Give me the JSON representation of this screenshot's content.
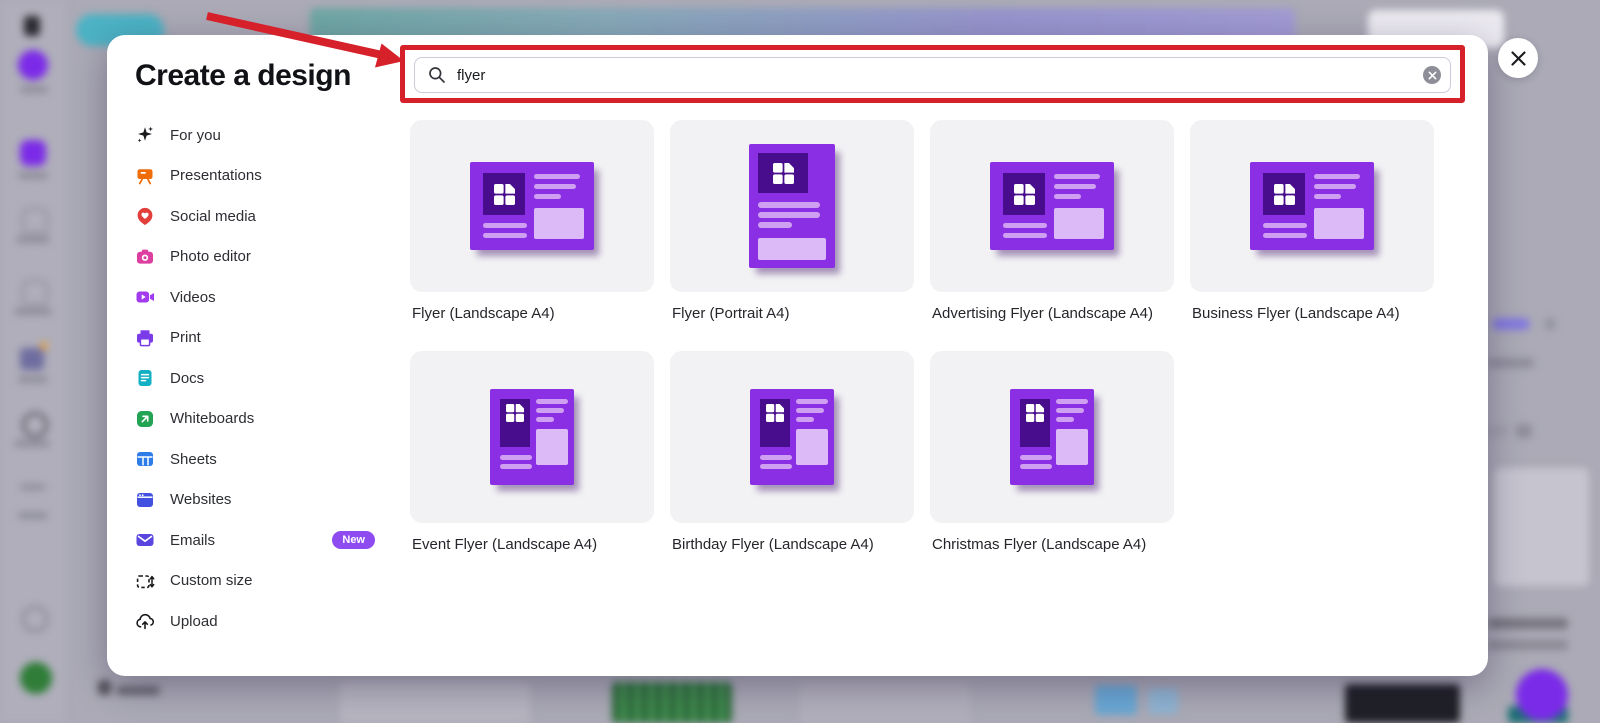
{
  "colors": {
    "annotation-red": "#d6212b",
    "flyer-purple": "#8b2fe4",
    "flyer-dark": "#470d8d",
    "flyer-line": "#cf9ff2",
    "flyer-light": "#dcb9f7",
    "card-bg": "#f2f2f4",
    "badge-purple": "#8d4bf0"
  },
  "modal": {
    "title": "Create a design",
    "search": {
      "value": "flyer",
      "search_icon": "magnifying-glass",
      "clear_icon": "circle-x"
    },
    "close_icon": "x"
  },
  "sidebar": {
    "items": [
      {
        "label": "For you",
        "icon": "sparkles-icon",
        "color": "#1a1a1e"
      },
      {
        "label": "Presentations",
        "icon": "presentation-icon",
        "color": "#ef6c08"
      },
      {
        "label": "Social media",
        "icon": "heart-pin-icon",
        "color": "#e23e3a"
      },
      {
        "label": "Photo editor",
        "icon": "camera-icon",
        "color": "#dd3fa0"
      },
      {
        "label": "Videos",
        "icon": "video-icon",
        "color": "#a03bee"
      },
      {
        "label": "Print",
        "icon": "printer-icon",
        "color": "#7b3be8"
      },
      {
        "label": "Docs",
        "icon": "document-icon",
        "color": "#12b0c4"
      },
      {
        "label": "Whiteboards",
        "icon": "whiteboard-icon",
        "color": "#23a455"
      },
      {
        "label": "Sheets",
        "icon": "spreadsheet-icon",
        "color": "#2e7ce8"
      },
      {
        "label": "Websites",
        "icon": "browser-icon",
        "color": "#4351e0"
      },
      {
        "label": "Emails",
        "icon": "envelope-icon",
        "color": "#5a45e0",
        "badge": "New"
      },
      {
        "label": "Custom size",
        "icon": "resize-icon",
        "color": "#1a1a1e"
      },
      {
        "label": "Upload",
        "icon": "cloud-upload-icon",
        "color": "#1a1a1e"
      }
    ]
  },
  "templates": [
    {
      "label": "Flyer (Landscape A4)",
      "variant": "landscape"
    },
    {
      "label": "Flyer (Portrait A4)",
      "variant": "portrait"
    },
    {
      "label": "Advertising Flyer (Landscape A4)",
      "variant": "landscape"
    },
    {
      "label": "Business Flyer (Landscape A4)",
      "variant": "landscape"
    },
    {
      "label": "Event Flyer (Landscape A4)",
      "variant": "square"
    },
    {
      "label": "Birthday Flyer (Landscape A4)",
      "variant": "square"
    },
    {
      "label": "Christmas Flyer (Landscape A4)",
      "variant": "square"
    }
  ]
}
